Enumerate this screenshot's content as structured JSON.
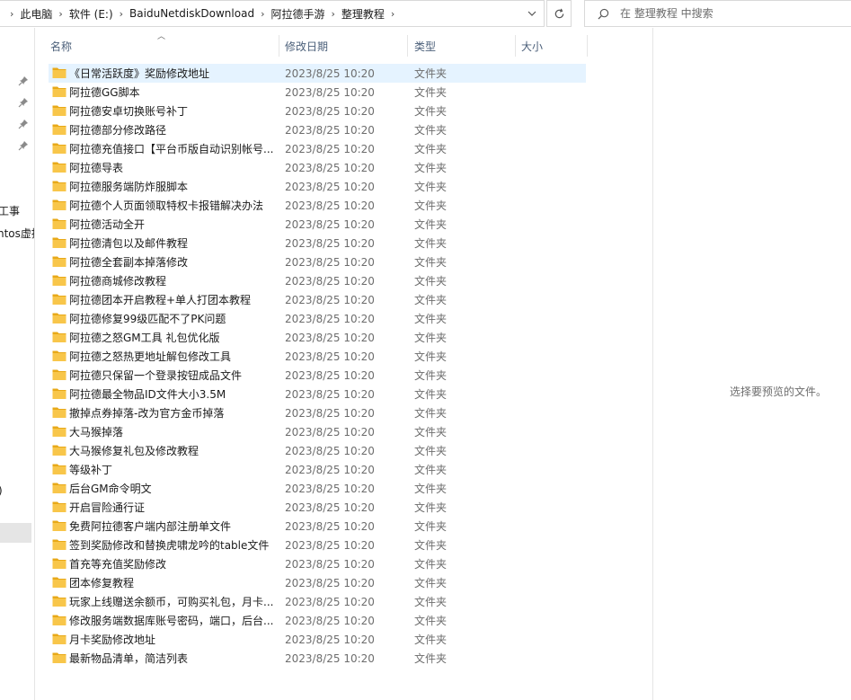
{
  "address": {
    "crumbs": [
      "此电脑",
      "软件 (E:)",
      "BaiduNetdiskDownload",
      "阿拉德手游",
      "整理教程"
    ],
    "separator": "›"
  },
  "search": {
    "placeholder": "在 整理教程 中搜索"
  },
  "nav": {
    "partial_items": [
      "工事",
      "ntos虚拟",
      ")"
    ]
  },
  "columns": {
    "name": "名称",
    "date": "修改日期",
    "type": "类型",
    "size": "大小"
  },
  "files": [
    {
      "name": "《日常活跃度》奖励修改地址",
      "date": "2023/8/25 10:20",
      "type": "文件夹"
    },
    {
      "name": "阿拉德GG脚本",
      "date": "2023/8/25 10:20",
      "type": "文件夹"
    },
    {
      "name": "阿拉德安卓切换账号补丁",
      "date": "2023/8/25 10:20",
      "type": "文件夹"
    },
    {
      "name": "阿拉德部分修改路径",
      "date": "2023/8/25 10:20",
      "type": "文件夹"
    },
    {
      "name": "阿拉德充值接口【平台币版自动识别帐号...",
      "date": "2023/8/25 10:20",
      "type": "文件夹"
    },
    {
      "name": "阿拉德导表",
      "date": "2023/8/25 10:20",
      "type": "文件夹"
    },
    {
      "name": "阿拉德服务端防炸服脚本",
      "date": "2023/8/25 10:20",
      "type": "文件夹"
    },
    {
      "name": "阿拉德个人页面领取特权卡报错解决办法",
      "date": "2023/8/25 10:20",
      "type": "文件夹"
    },
    {
      "name": "阿拉德活动全开",
      "date": "2023/8/25 10:20",
      "type": "文件夹"
    },
    {
      "name": "阿拉德清包以及邮件教程",
      "date": "2023/8/25 10:20",
      "type": "文件夹"
    },
    {
      "name": "阿拉德全套副本掉落修改",
      "date": "2023/8/25 10:20",
      "type": "文件夹"
    },
    {
      "name": "阿拉德商城修改教程",
      "date": "2023/8/25 10:20",
      "type": "文件夹"
    },
    {
      "name": "阿拉德团本开启教程+单人打团本教程",
      "date": "2023/8/25 10:20",
      "type": "文件夹"
    },
    {
      "name": "阿拉德修复99级匹配不了PK问题",
      "date": "2023/8/25 10:20",
      "type": "文件夹"
    },
    {
      "name": "阿拉德之怒GM工具 礼包优化版",
      "date": "2023/8/25 10:20",
      "type": "文件夹"
    },
    {
      "name": "阿拉德之怒热更地址解包修改工具",
      "date": "2023/8/25 10:20",
      "type": "文件夹"
    },
    {
      "name": "阿拉德只保留一个登录按钮成品文件",
      "date": "2023/8/25 10:20",
      "type": "文件夹"
    },
    {
      "name": "阿拉德最全物品ID文件大小3.5M",
      "date": "2023/8/25 10:20",
      "type": "文件夹"
    },
    {
      "name": "撤掉点券掉落-改为官方金币掉落",
      "date": "2023/8/25 10:20",
      "type": "文件夹"
    },
    {
      "name": "大马猴掉落",
      "date": "2023/8/25 10:20",
      "type": "文件夹"
    },
    {
      "name": "大马猴修复礼包及修改教程",
      "date": "2023/8/25 10:20",
      "type": "文件夹"
    },
    {
      "name": "等级补丁",
      "date": "2023/8/25 10:20",
      "type": "文件夹"
    },
    {
      "name": "后台GM命令明文",
      "date": "2023/8/25 10:20",
      "type": "文件夹"
    },
    {
      "name": "开启冒险通行证",
      "date": "2023/8/25 10:20",
      "type": "文件夹"
    },
    {
      "name": "免费阿拉德客户端内部注册单文件",
      "date": "2023/8/25 10:20",
      "type": "文件夹"
    },
    {
      "name": "签到奖励修改和替换虎啸龙吟的table文件",
      "date": "2023/8/25 10:20",
      "type": "文件夹"
    },
    {
      "name": "首充等充值奖励修改",
      "date": "2023/8/25 10:20",
      "type": "文件夹"
    },
    {
      "name": "团本修复教程",
      "date": "2023/8/25 10:20",
      "type": "文件夹"
    },
    {
      "name": "玩家上线赠送余额币，可购买礼包，月卡...",
      "date": "2023/8/25 10:20",
      "type": "文件夹"
    },
    {
      "name": "修改服务端数据库账号密码，端口，后台...",
      "date": "2023/8/25 10:20",
      "type": "文件夹"
    },
    {
      "name": "月卡奖励修改地址",
      "date": "2023/8/25 10:20",
      "type": "文件夹"
    },
    {
      "name": "最新物品清单，简洁列表",
      "date": "2023/8/25 10:20",
      "type": "文件夹"
    }
  ],
  "preview": {
    "message": "选择要预览的文件。"
  },
  "colors": {
    "selected_row": "#e5f3ff",
    "folder": "#f8c64a",
    "header_text": "#4c607a"
  }
}
